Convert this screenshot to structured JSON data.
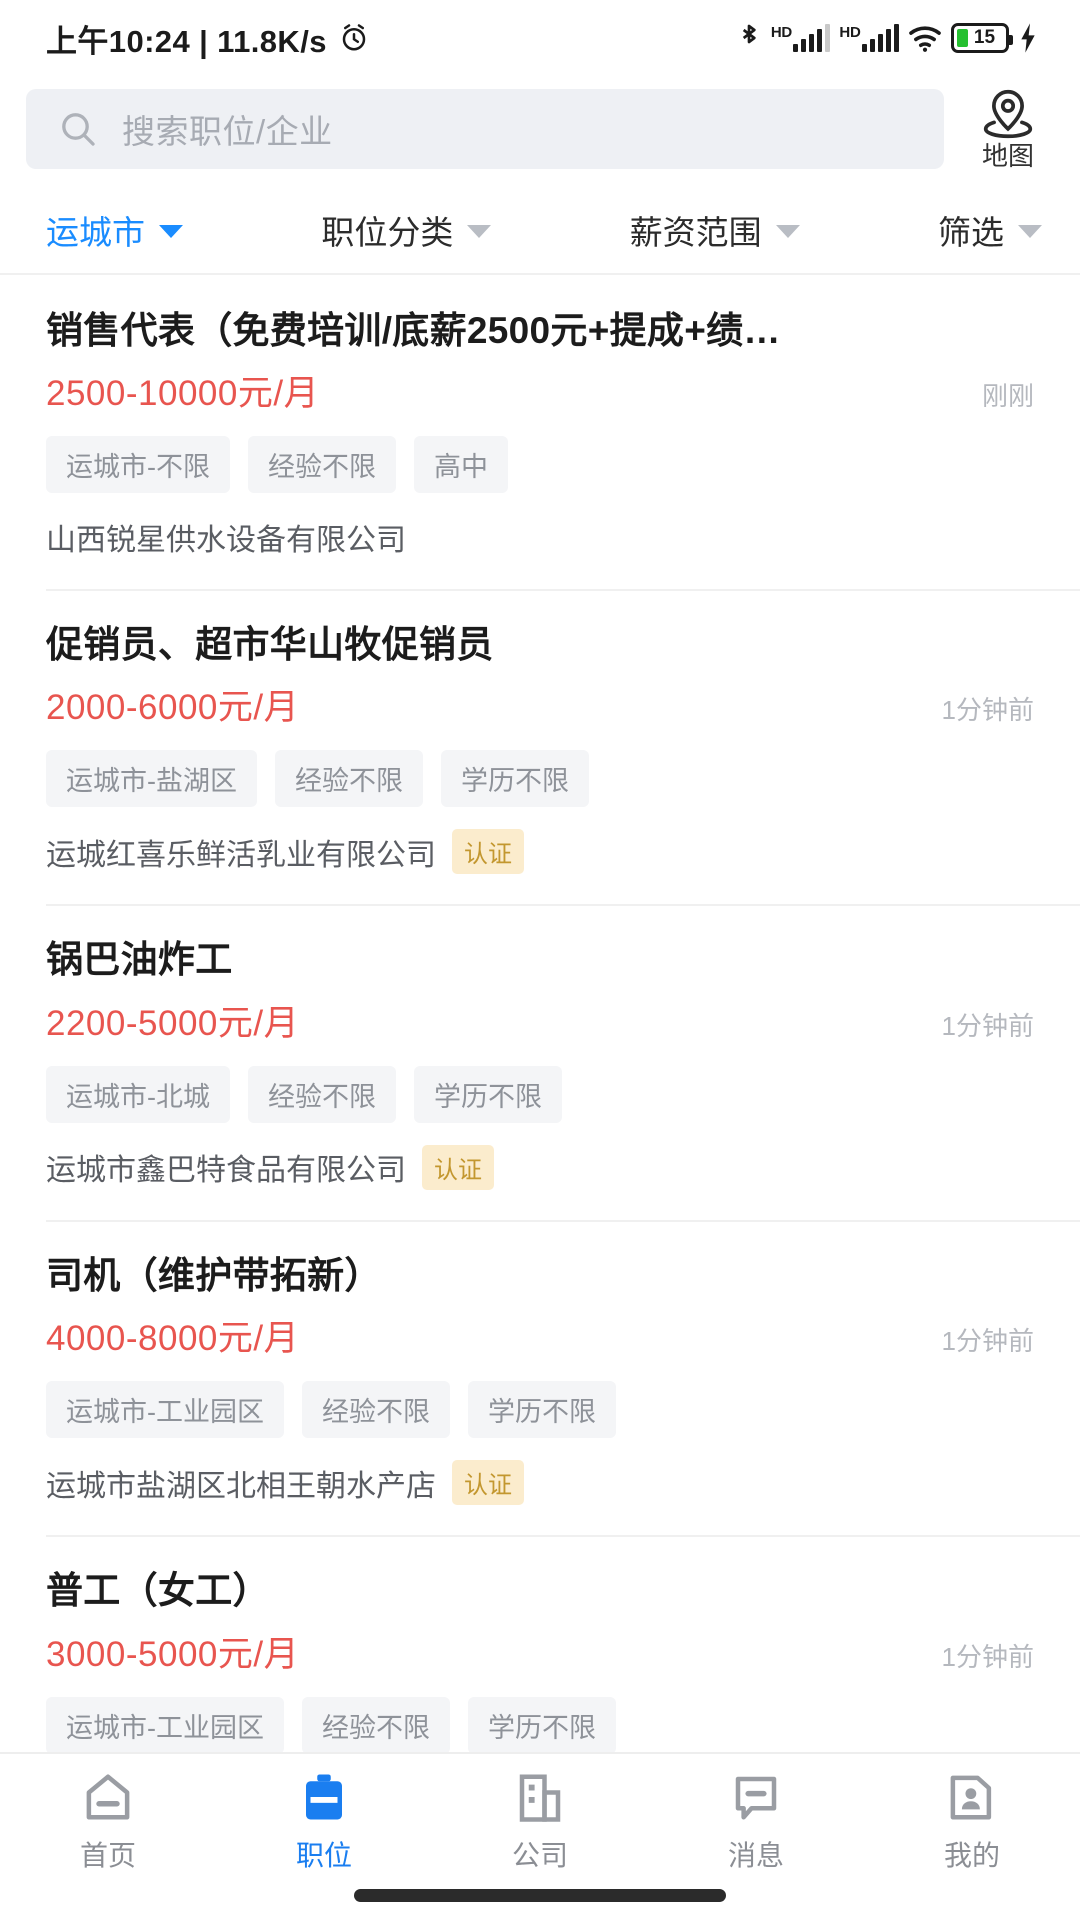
{
  "statusbar": {
    "time_text": "上午10:24 | 11.8K/s",
    "alarm_icon": "alarm-icon",
    "bluetooth_icon": "bluetooth-icon",
    "signal1_label": "HD",
    "signal2_label": "HD",
    "wifi_icon": "wifi-icon",
    "battery_level": "15",
    "charging_icon": "lightning-bolt-icon"
  },
  "search": {
    "placeholder": "搜索职位/企业",
    "value": "",
    "icon": "search-icon",
    "map_label": "地图",
    "map_icon": "map-pin-icon"
  },
  "filters": [
    {
      "label": "运城市",
      "active": true
    },
    {
      "label": "职位分类",
      "active": false
    },
    {
      "label": "薪资范围",
      "active": false
    },
    {
      "label": "筛选",
      "active": false
    }
  ],
  "jobs": [
    {
      "title": "销售代表（免费培训/底薪2500元+提成+绩…",
      "salary": "2500-10000元/月",
      "time": "刚刚",
      "tags": [
        "运城市-不限",
        "经验不限",
        "高中"
      ],
      "company": "山西锐星供水设备有限公司",
      "verified": ""
    },
    {
      "title": "促销员、超市华山牧促销员",
      "salary": "2000-6000元/月",
      "time": "1分钟前",
      "tags": [
        "运城市-盐湖区",
        "经验不限",
        "学历不限"
      ],
      "company": "运城红喜乐鲜活乳业有限公司",
      "verified": "认证"
    },
    {
      "title": "锅巴油炸工",
      "salary": "2200-5000元/月",
      "time": "1分钟前",
      "tags": [
        "运城市-北城",
        "经验不限",
        "学历不限"
      ],
      "company": "运城市鑫巴特食品有限公司",
      "verified": "认证"
    },
    {
      "title": "司机（维护带拓新）",
      "salary": "4000-8000元/月",
      "time": "1分钟前",
      "tags": [
        "运城市-工业园区",
        "经验不限",
        "学历不限"
      ],
      "company": "运城市盐湖区北相王朝水产店",
      "verified": "认证"
    },
    {
      "title": "普工（女工）",
      "salary": "3000-5000元/月",
      "time": "1分钟前",
      "tags": [
        "运城市-工业园区",
        "经验不限",
        "学历不限"
      ],
      "company": "",
      "verified": ""
    }
  ],
  "tabbar": [
    {
      "label": "首页",
      "icon": "home-icon",
      "active": false
    },
    {
      "label": "职位",
      "icon": "briefcase-icon",
      "active": true
    },
    {
      "label": "公司",
      "icon": "building-icon",
      "active": false
    },
    {
      "label": "消息",
      "icon": "message-icon",
      "active": false
    },
    {
      "label": "我的",
      "icon": "profile-card-icon",
      "active": false
    }
  ],
  "colors": {
    "accent_blue": "#1a8cff",
    "salary_red": "#e8554f",
    "tag_bg": "#f4f5f7",
    "verified_bg": "#fbeccd",
    "verified_text": "#c3972f",
    "battery_green": "#25c030"
  }
}
